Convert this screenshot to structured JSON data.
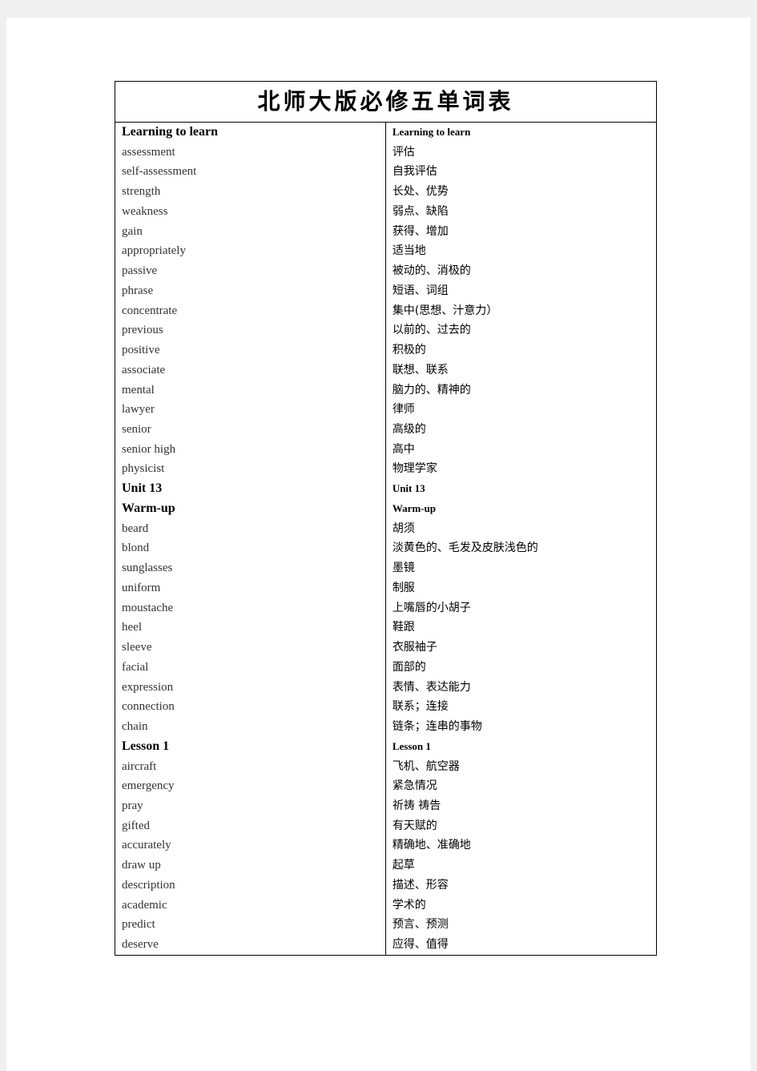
{
  "title": "北师大版必修五单词表",
  "rows": [
    {
      "en": "Learning  to  learn",
      "zh": "Learning  to  learn",
      "heading": true
    },
    {
      "en": "assessment",
      "zh": "评估"
    },
    {
      "en": "self-assessment",
      "zh": "自我评估"
    },
    {
      "en": "strength",
      "zh": "长处、优势"
    },
    {
      "en": "weakness",
      "zh": "弱点、缺陷"
    },
    {
      "en": "gain",
      "zh": "获得、增加"
    },
    {
      "en": "appropriately",
      "zh": "适当地"
    },
    {
      "en": "passive",
      "zh": "被动的、消极的"
    },
    {
      "en": "phrase",
      "zh": "短语、词组"
    },
    {
      "en": "concentrate",
      "zh": "集中(思想、汁意力）"
    },
    {
      "en": "previous",
      "zh": "以前的、过去的"
    },
    {
      "en": "positive",
      "zh": "积极的"
    },
    {
      "en": "associate",
      "zh": "联想、联系"
    },
    {
      "en": "mental",
      "zh": "脑力的、精神的"
    },
    {
      "en": "lawyer",
      "zh": "律师"
    },
    {
      "en": "senior",
      "zh": "高级的"
    },
    {
      "en": "senior  high",
      "zh": "高中"
    },
    {
      "en": "physicist",
      "zh": "物理学家"
    },
    {
      "en": "Unit  13",
      "zh": "Unit  13",
      "heading": true
    },
    {
      "en": "Warm-up",
      "zh": "Warm-up",
      "heading": true
    },
    {
      "en": "beard",
      "zh": "胡须"
    },
    {
      "en": "blond",
      "zh": "淡黄色的、毛发及皮肤浅色的"
    },
    {
      "en": "sunglasses",
      "zh": "墨镜"
    },
    {
      "en": "uniform",
      "zh": "制服"
    },
    {
      "en": "moustache",
      "zh": "上嘴唇的小胡子"
    },
    {
      "en": "heel",
      "zh": "鞋跟"
    },
    {
      "en": "sleeve",
      "zh": "衣服袖子"
    },
    {
      "en": "facial",
      "zh": "面部的"
    },
    {
      "en": "expression",
      "zh": "表情、表达能力"
    },
    {
      "en": "connection",
      "zh": "联系；连接"
    },
    {
      "en": "chain",
      "zh": "链条；连串的事物"
    },
    {
      "en": "Lesson  1",
      "zh": "Lesson  1",
      "heading": true
    },
    {
      "en": "aircraft",
      "zh": "飞机、航空器"
    },
    {
      "en": "emergency",
      "zh": "紧急情况"
    },
    {
      "en": "pray",
      "zh": "祈祷   祷告"
    },
    {
      "en": "gifted",
      "zh": "有天赋的"
    },
    {
      "en": "accurately",
      "zh": "精确地、准确地"
    },
    {
      "en": "draw  up",
      "zh": "起草"
    },
    {
      "en": "description",
      "zh": "描述、形容"
    },
    {
      "en": "academic",
      "zh": "学术的"
    },
    {
      "en": "predict",
      "zh": "预言、预测"
    },
    {
      "en": "deserve",
      "zh": "应得、值得"
    }
  ]
}
